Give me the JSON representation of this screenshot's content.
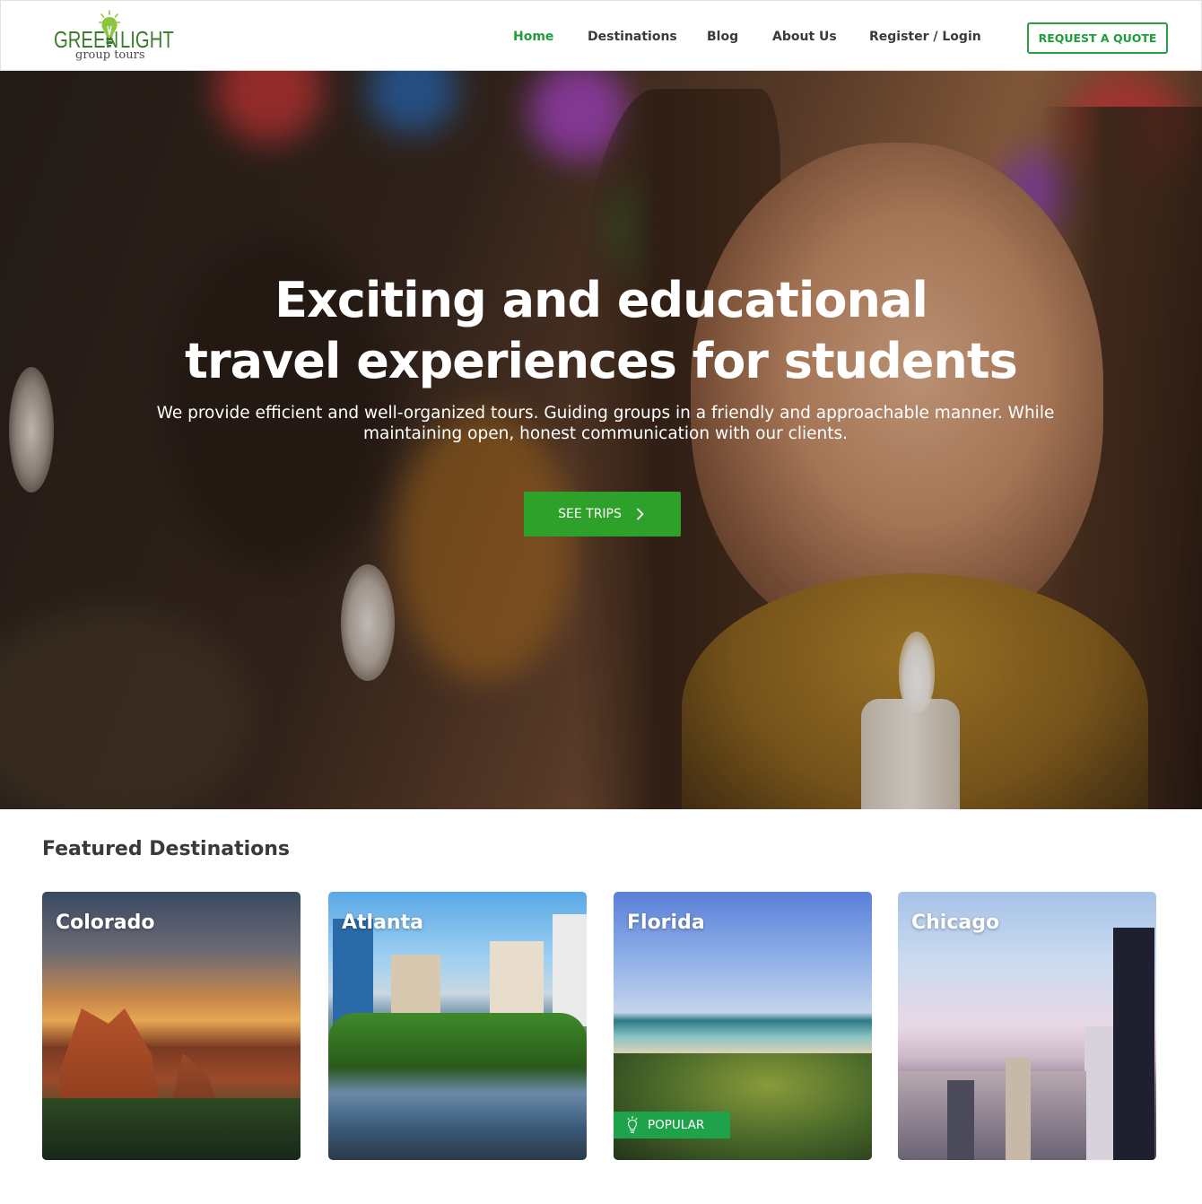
{
  "brand": {
    "logo_word_1": "GREEN",
    "logo_word_2": "LIGHT",
    "logo_sub": "group tours",
    "accent_color": "#1e9e3b"
  },
  "nav": {
    "items": [
      {
        "label": "Home",
        "active": true
      },
      {
        "label": "Destinations",
        "active": false
      },
      {
        "label": "Blog",
        "active": false
      },
      {
        "label": "About Us",
        "active": false
      },
      {
        "label": "Register / Login",
        "active": false
      }
    ],
    "cta_label": "REQUEST A QUOTE"
  },
  "hero": {
    "title_line_1": "Exciting and educational",
    "title_line_2": "travel experiences for students",
    "subtitle": "We provide efficient and well-organized tours. Guiding groups in a friendly and approachable manner. While maintaining open, honest communication with our clients.",
    "button_label": "SEE TRIPS",
    "button_icon": "chevron-right-icon"
  },
  "featured": {
    "title": "Featured Destinations",
    "cards": [
      {
        "name": "Colorado",
        "badge": null
      },
      {
        "name": "Atlanta",
        "badge": null
      },
      {
        "name": "Florida",
        "badge": "POPULAR",
        "badge_icon": "lightbulb-icon"
      },
      {
        "name": "Chicago",
        "badge": null
      }
    ]
  }
}
